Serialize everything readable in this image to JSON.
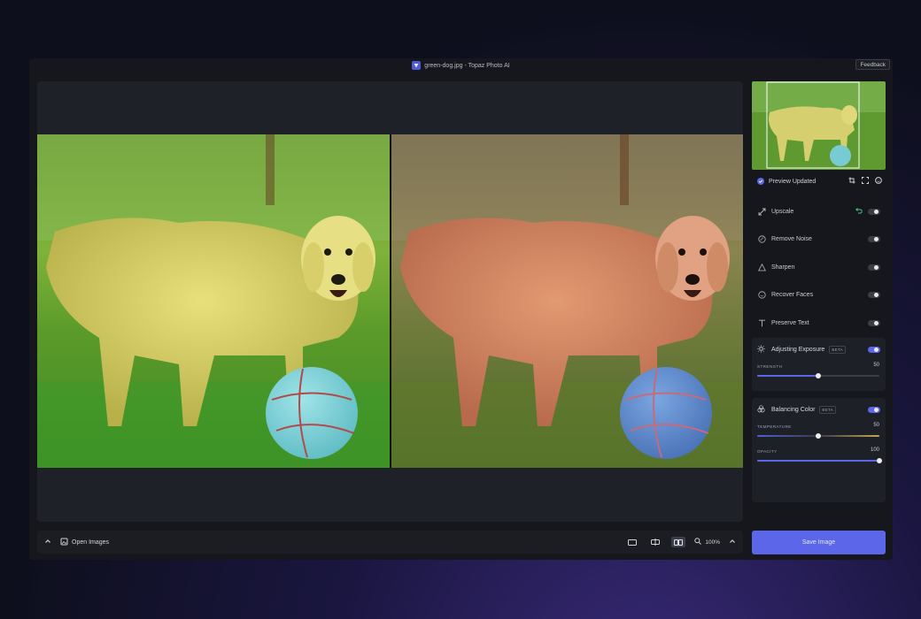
{
  "window": {
    "title": "green-dog.jpg - Topaz Photo AI",
    "feedback_label": "Feedback"
  },
  "preview": {
    "status": "Preview Updated"
  },
  "models": [
    {
      "label": "Upscale",
      "icon": "resize-diagonal-icon",
      "enabled": false,
      "has_undo": true
    },
    {
      "label": "Remove Noise",
      "icon": "noise-icon",
      "enabled": false
    },
    {
      "label": "Sharpen",
      "icon": "triangle-icon",
      "enabled": false
    },
    {
      "label": "Recover Faces",
      "icon": "face-icon",
      "enabled": false
    },
    {
      "label": "Preserve Text",
      "icon": "text-icon",
      "enabled": false
    }
  ],
  "exposure": {
    "label": "Adjusting Exposure",
    "badge": "BETA",
    "enabled": true,
    "strength_label": "STRENGTH",
    "strength_value": "50",
    "strength_fraction": 0.5
  },
  "color": {
    "label": "Balancing Color",
    "badge": "BETA",
    "enabled": true,
    "temperature_label": "TEMPERATURE",
    "temperature_value": "50",
    "temperature_fraction": 0.5,
    "opacity_label": "OPACITY",
    "opacity_value": "100",
    "opacity_fraction": 1.0
  },
  "bottombar": {
    "open_images_label": "Open Images",
    "zoom_level": "100%"
  },
  "save_label": "Save Image",
  "colors": {
    "accent": "#5b67e8",
    "undo": "#3fcf7a"
  }
}
